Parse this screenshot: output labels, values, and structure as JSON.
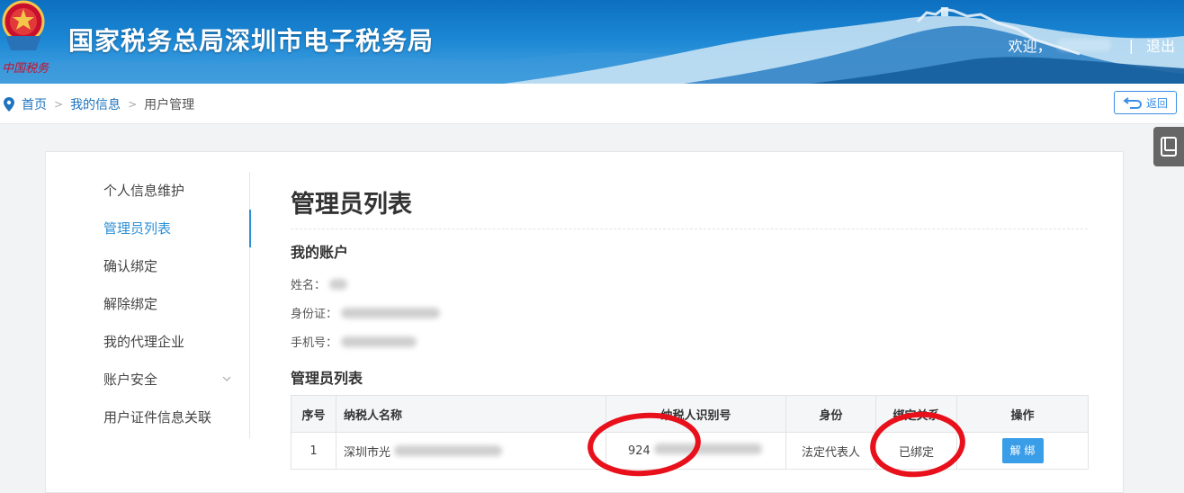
{
  "header": {
    "title": "国家税务总局深圳市电子税务局",
    "welcome": "欢迎，",
    "separator": "|",
    "logout": "退出",
    "logo_caption": "中国税务"
  },
  "breadcrumb": {
    "home": "首页",
    "my_info": "我的信息",
    "current": "用户管理",
    "sep": ">"
  },
  "back_button": {
    "label": "返回"
  },
  "sidebar": {
    "items": [
      {
        "label": "个人信息维护",
        "active": false
      },
      {
        "label": "管理员列表",
        "active": true
      },
      {
        "label": "确认绑定",
        "active": false
      },
      {
        "label": "解除绑定",
        "active": false
      },
      {
        "label": "我的代理企业",
        "active": false
      },
      {
        "label": "账户安全",
        "active": false,
        "has_submenu": true
      },
      {
        "label": "用户证件信息关联",
        "active": false
      }
    ]
  },
  "main": {
    "page_title": "管理员列表",
    "account_section": "我的账户",
    "name_label": "姓名：",
    "id_label": "身份证：",
    "phone_label": "手机号：",
    "list_section": "管理员列表",
    "table": {
      "headers": [
        "序号",
        "纳税人名称",
        "纳税人识别号",
        "身份",
        "绑定关系",
        "操作"
      ],
      "rows": [
        {
          "index": "1",
          "taxpayer_name": "深圳市光",
          "taxpayer_id": "924",
          "role": "法定代表人",
          "binding": "已绑定",
          "action": "解 绑"
        }
      ]
    }
  },
  "colors": {
    "brand_blue": "#1a86d4",
    "active_nav": "#2a8fd6",
    "annotation_red": "#e8101a"
  }
}
